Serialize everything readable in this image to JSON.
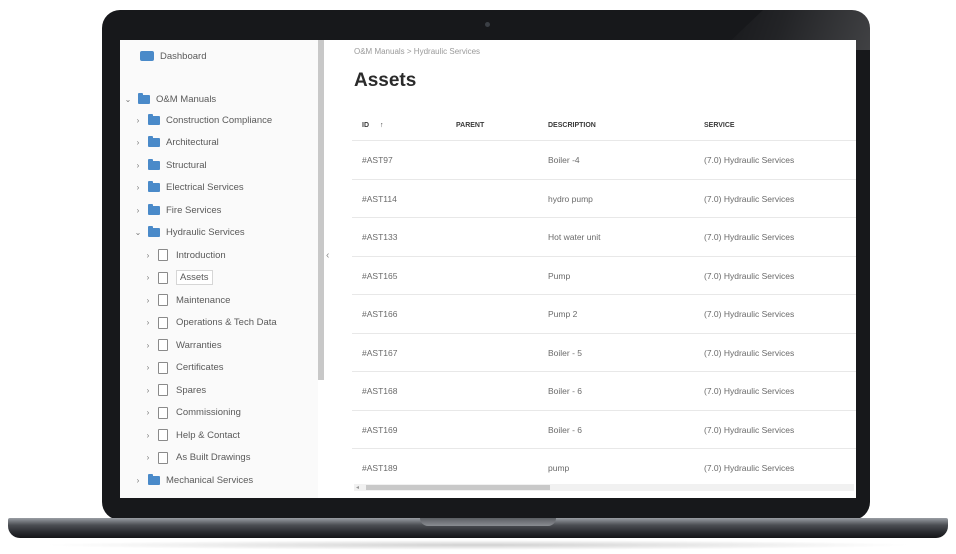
{
  "sidebar": {
    "dashboard": "Dashboard",
    "root": "O&M Manuals",
    "folders_top": [
      "Construction Compliance",
      "Architectural",
      "Structural",
      "Electrical Services",
      "Fire Services"
    ],
    "open_folder": "Hydraulic Services",
    "pages": [
      "Introduction",
      "Assets",
      "Maintenance",
      "Operations & Tech Data",
      "Warranties",
      "Certificates",
      "Spares",
      "Commissioning",
      "Help & Contact",
      "As Built Drawings"
    ],
    "active_page": "Assets",
    "folders_bottom": [
      "Mechanical Services"
    ]
  },
  "main": {
    "breadcrumb": "O&M Manuals > Hydraulic Services",
    "title": "Assets",
    "columns": {
      "id": "ID",
      "sort": "↑",
      "parent": "PARENT",
      "description": "DESCRIPTION",
      "service": "SERVICE"
    },
    "rows": [
      {
        "id": "#AST97",
        "parent": "",
        "description": "Boiler -4",
        "service": "(7.0) Hydraulic Services"
      },
      {
        "id": "#AST114",
        "parent": "",
        "description": "hydro pump",
        "service": "(7.0) Hydraulic Services"
      },
      {
        "id": "#AST133",
        "parent": "",
        "description": "Hot water unit",
        "service": "(7.0) Hydraulic Services"
      },
      {
        "id": "#AST165",
        "parent": "",
        "description": "Pump",
        "service": "(7.0) Hydraulic Services"
      },
      {
        "id": "#AST166",
        "parent": "",
        "description": "Pump 2",
        "service": "(7.0) Hydraulic Services"
      },
      {
        "id": "#AST167",
        "parent": "",
        "description": "Boiler - 5",
        "service": "(7.0) Hydraulic Services"
      },
      {
        "id": "#AST168",
        "parent": "",
        "description": "Boiler - 6",
        "service": "(7.0) Hydraulic Services"
      },
      {
        "id": "#AST169",
        "parent": "",
        "description": "Boiler - 6",
        "service": "(7.0) Hydraulic Services"
      },
      {
        "id": "#AST189",
        "parent": "",
        "description": "pump",
        "service": "(7.0) Hydraulic Services"
      }
    ]
  },
  "colors": {
    "accent": "#4a8ac9",
    "bezel": "#17181b"
  },
  "icons": {
    "folder": "folder-icon",
    "page": "document-icon",
    "dashboard": "dashboard-icon",
    "expand": "chevron-right-icon",
    "collapse": "chevron-down-icon",
    "sidebar_toggle": "chevron-left-icon"
  }
}
